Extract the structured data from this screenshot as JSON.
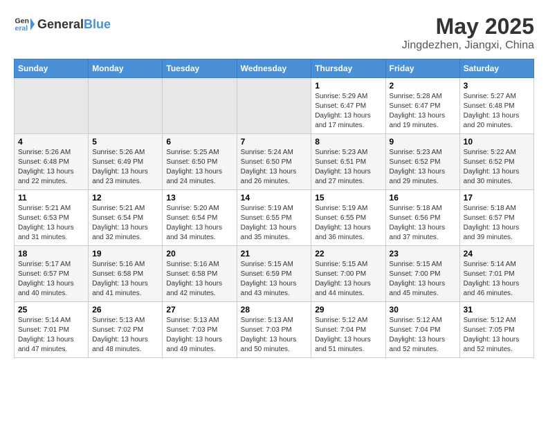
{
  "logo": {
    "text_general": "General",
    "text_blue": "Blue"
  },
  "header": {
    "title": "May 2025",
    "subtitle": "Jingdezhen, Jiangxi, China"
  },
  "weekdays": [
    "Sunday",
    "Monday",
    "Tuesday",
    "Wednesday",
    "Thursday",
    "Friday",
    "Saturday"
  ],
  "weeks": [
    {
      "days": [
        {
          "num": "",
          "empty": true
        },
        {
          "num": "",
          "empty": true
        },
        {
          "num": "",
          "empty": true
        },
        {
          "num": "",
          "empty": true
        },
        {
          "num": "1",
          "sunrise": "5:29 AM",
          "sunset": "6:47 PM",
          "daylight": "13 hours and 17 minutes."
        },
        {
          "num": "2",
          "sunrise": "5:28 AM",
          "sunset": "6:47 PM",
          "daylight": "13 hours and 19 minutes."
        },
        {
          "num": "3",
          "sunrise": "5:27 AM",
          "sunset": "6:48 PM",
          "daylight": "13 hours and 20 minutes."
        }
      ]
    },
    {
      "days": [
        {
          "num": "4",
          "sunrise": "5:26 AM",
          "sunset": "6:48 PM",
          "daylight": "13 hours and 22 minutes."
        },
        {
          "num": "5",
          "sunrise": "5:26 AM",
          "sunset": "6:49 PM",
          "daylight": "13 hours and 23 minutes."
        },
        {
          "num": "6",
          "sunrise": "5:25 AM",
          "sunset": "6:50 PM",
          "daylight": "13 hours and 24 minutes."
        },
        {
          "num": "7",
          "sunrise": "5:24 AM",
          "sunset": "6:50 PM",
          "daylight": "13 hours and 26 minutes."
        },
        {
          "num": "8",
          "sunrise": "5:23 AM",
          "sunset": "6:51 PM",
          "daylight": "13 hours and 27 minutes."
        },
        {
          "num": "9",
          "sunrise": "5:23 AM",
          "sunset": "6:52 PM",
          "daylight": "13 hours and 29 minutes."
        },
        {
          "num": "10",
          "sunrise": "5:22 AM",
          "sunset": "6:52 PM",
          "daylight": "13 hours and 30 minutes."
        }
      ]
    },
    {
      "days": [
        {
          "num": "11",
          "sunrise": "5:21 AM",
          "sunset": "6:53 PM",
          "daylight": "13 hours and 31 minutes."
        },
        {
          "num": "12",
          "sunrise": "5:21 AM",
          "sunset": "6:54 PM",
          "daylight": "13 hours and 32 minutes."
        },
        {
          "num": "13",
          "sunrise": "5:20 AM",
          "sunset": "6:54 PM",
          "daylight": "13 hours and 34 minutes."
        },
        {
          "num": "14",
          "sunrise": "5:19 AM",
          "sunset": "6:55 PM",
          "daylight": "13 hours and 35 minutes."
        },
        {
          "num": "15",
          "sunrise": "5:19 AM",
          "sunset": "6:55 PM",
          "daylight": "13 hours and 36 minutes."
        },
        {
          "num": "16",
          "sunrise": "5:18 AM",
          "sunset": "6:56 PM",
          "daylight": "13 hours and 37 minutes."
        },
        {
          "num": "17",
          "sunrise": "5:18 AM",
          "sunset": "6:57 PM",
          "daylight": "13 hours and 39 minutes."
        }
      ]
    },
    {
      "days": [
        {
          "num": "18",
          "sunrise": "5:17 AM",
          "sunset": "6:57 PM",
          "daylight": "13 hours and 40 minutes."
        },
        {
          "num": "19",
          "sunrise": "5:16 AM",
          "sunset": "6:58 PM",
          "daylight": "13 hours and 41 minutes."
        },
        {
          "num": "20",
          "sunrise": "5:16 AM",
          "sunset": "6:58 PM",
          "daylight": "13 hours and 42 minutes."
        },
        {
          "num": "21",
          "sunrise": "5:15 AM",
          "sunset": "6:59 PM",
          "daylight": "13 hours and 43 minutes."
        },
        {
          "num": "22",
          "sunrise": "5:15 AM",
          "sunset": "7:00 PM",
          "daylight": "13 hours and 44 minutes."
        },
        {
          "num": "23",
          "sunrise": "5:15 AM",
          "sunset": "7:00 PM",
          "daylight": "13 hours and 45 minutes."
        },
        {
          "num": "24",
          "sunrise": "5:14 AM",
          "sunset": "7:01 PM",
          "daylight": "13 hours and 46 minutes."
        }
      ]
    },
    {
      "days": [
        {
          "num": "25",
          "sunrise": "5:14 AM",
          "sunset": "7:01 PM",
          "daylight": "13 hours and 47 minutes."
        },
        {
          "num": "26",
          "sunrise": "5:13 AM",
          "sunset": "7:02 PM",
          "daylight": "13 hours and 48 minutes."
        },
        {
          "num": "27",
          "sunrise": "5:13 AM",
          "sunset": "7:03 PM",
          "daylight": "13 hours and 49 minutes."
        },
        {
          "num": "28",
          "sunrise": "5:13 AM",
          "sunset": "7:03 PM",
          "daylight": "13 hours and 50 minutes."
        },
        {
          "num": "29",
          "sunrise": "5:12 AM",
          "sunset": "7:04 PM",
          "daylight": "13 hours and 51 minutes."
        },
        {
          "num": "30",
          "sunrise": "5:12 AM",
          "sunset": "7:04 PM",
          "daylight": "13 hours and 52 minutes."
        },
        {
          "num": "31",
          "sunrise": "5:12 AM",
          "sunset": "7:05 PM",
          "daylight": "13 hours and 52 minutes."
        }
      ]
    }
  ],
  "labels": {
    "sunrise": "Sunrise:",
    "sunset": "Sunset:",
    "daylight": "Daylight:"
  }
}
